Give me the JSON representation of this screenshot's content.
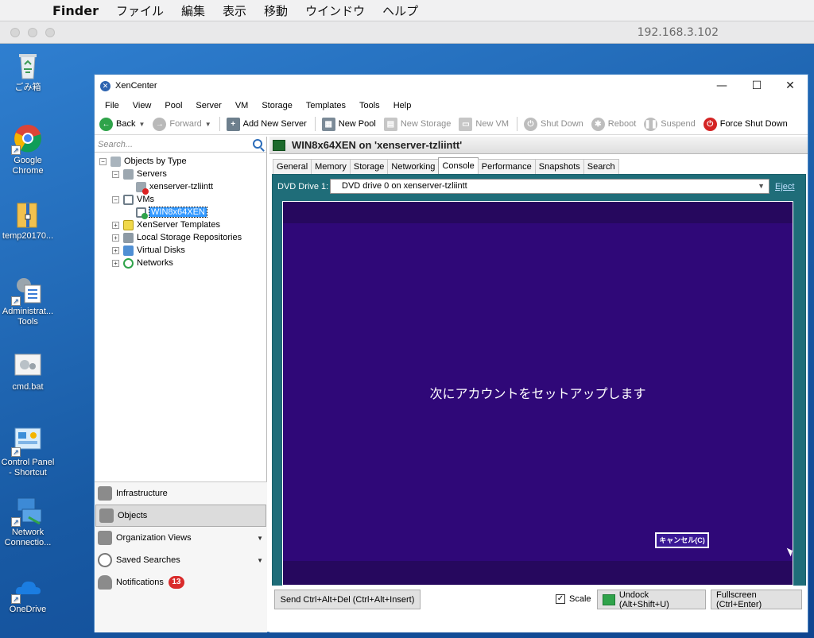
{
  "mac": {
    "apple_icon": "apple-logo-icon",
    "app_name": "Finder",
    "menus": [
      "ファイル",
      "編集",
      "表示",
      "移動",
      "ウインドウ",
      "ヘルプ"
    ]
  },
  "rdp": {
    "ip": "192.168.3.102"
  },
  "desktop_icons": [
    {
      "label": "ごみ箱",
      "icon": "recycle-bin-icon"
    },
    {
      "label": "Google Chrome",
      "icon": "chrome-icon"
    },
    {
      "label": "temp20170...",
      "icon": "folder-zip-icon"
    },
    {
      "label": "Administrat... Tools",
      "icon": "admin-tools-icon"
    },
    {
      "label": "cmd.bat",
      "icon": "batch-file-icon"
    },
    {
      "label": "Control Panel - Shortcut",
      "icon": "control-panel-icon"
    },
    {
      "label": "Network Connectio...",
      "icon": "network-connections-icon"
    },
    {
      "label": "OneDrive",
      "icon": "onedrive-icon"
    }
  ],
  "xencenter": {
    "title": "XenCenter",
    "window_controls": {
      "minimize": "—",
      "maximize": "☐",
      "close": "✕"
    },
    "menu": [
      "File",
      "View",
      "Pool",
      "Server",
      "VM",
      "Storage",
      "Templates",
      "Tools",
      "Help"
    ],
    "toolbar": {
      "back": "Back",
      "forward": "Forward",
      "add_server": "Add New Server",
      "new_pool": "New Pool",
      "new_storage": "New Storage",
      "new_vm": "New VM",
      "shut_down": "Shut Down",
      "reboot": "Reboot",
      "suspend": "Suspend",
      "force_shut_down": "Force Shut Down"
    },
    "search_placeholder": "Search...",
    "tree": {
      "root": "Objects by Type",
      "servers": "Servers",
      "server_item": "xenserver-tzliintt",
      "vms": "VMs",
      "vm_item": "WIN8x64XEN",
      "templates": "XenServer Templates",
      "local_storage": "Local Storage Repositories",
      "virtual_disks": "Virtual Disks",
      "networks": "Networks"
    },
    "nav": {
      "infrastructure": "Infrastructure",
      "objects": "Objects",
      "org_views": "Organization Views",
      "saved_searches": "Saved Searches",
      "notifications": "Notifications",
      "notifications_count": "13"
    },
    "vm_header": "WIN8x64XEN on 'xenserver-tzliintt'",
    "tabs": [
      "General",
      "Memory",
      "Storage",
      "Networking",
      "Console",
      "Performance",
      "Snapshots",
      "Search"
    ],
    "active_tab": "Console",
    "console": {
      "dvd_label": "DVD Drive 1:",
      "dvd_value": "DVD drive 0 on xenserver-tzliintt",
      "eject": "Eject",
      "setup_message": "次にアカウントをセットアップします",
      "cancel_button": "キャンセル(C)",
      "send_cad": "Send Ctrl+Alt+Del (Ctrl+Alt+Insert)",
      "scale_label": "Scale",
      "scale_checked": true,
      "undock": "Undock (Alt+Shift+U)",
      "fullscreen": "Fullscreen (Ctrl+Enter)"
    }
  }
}
